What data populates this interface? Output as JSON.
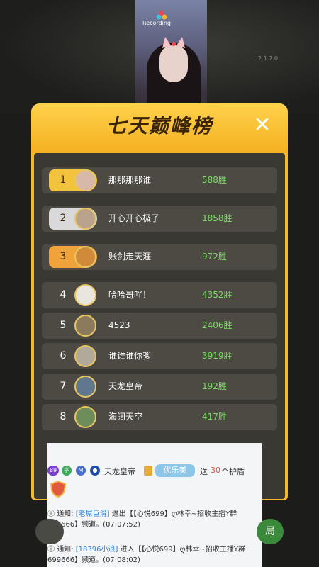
{
  "app": {
    "version": "2.1.7.0"
  },
  "video": {
    "watermark": "Recording"
  },
  "panel": {
    "title": "七天巅峰榜",
    "close_label": "✕"
  },
  "ranking": [
    {
      "rank": "1",
      "name": "那那那那谁",
      "wins": "588胜",
      "plate": "#f3c33e",
      "avatar": "#d8b9a8"
    },
    {
      "rank": "2",
      "name": "开心开心极了",
      "wins": "1858胜",
      "plate": "#d9d9d9",
      "avatar": "#b9a38c"
    },
    {
      "rank": "3",
      "name": "账剑走天涯",
      "wins": "972胜",
      "plate": "#f0a33a",
      "avatar": "#d08a3a"
    },
    {
      "rank": "4",
      "name": "哈哈哥吖！",
      "wins": "4352胜",
      "plate": "",
      "avatar": "#e9e6de"
    },
    {
      "rank": "5",
      "name": "4523",
      "wins": "2406胜",
      "plate": "",
      "avatar": "#8c7a5c"
    },
    {
      "rank": "6",
      "name": "谁谁谁你爹",
      "wins": "3919胜",
      "plate": "",
      "avatar": "#b1aa9a"
    },
    {
      "rank": "7",
      "name": "天龙皇帝",
      "wins": "192胜",
      "plate": "",
      "avatar": "#5f7890"
    },
    {
      "rank": "8",
      "name": "海阔天空",
      "wins": "417胜",
      "plate": "",
      "avatar": "#6d8d5a"
    }
  ],
  "chat": {
    "gift": {
      "badge_lv": "89",
      "badge_a": "字",
      "badge_b": "M",
      "user": "天龙皇帝",
      "fan_badge": "优乐美",
      "action": "送",
      "count": "30",
      "suffix": "个护盾"
    },
    "notice1": {
      "label": "通知:",
      "user": "老屌巨滑",
      "text": "退出【【心悦699】ღ林幸~招收主播Y群699666】频道。(07:07:52)"
    },
    "notice2": {
      "label": "通知:",
      "user": "18396小浪",
      "text": "进入【【心悦699】ღ林幸~招收主播Y群699666】频道。(07:08:02)"
    }
  },
  "bottom": {
    "right_label": "局"
  },
  "colors": {
    "accent": "#f3b92a",
    "wins": "#7bdc64",
    "link": "#2e7fd1"
  }
}
